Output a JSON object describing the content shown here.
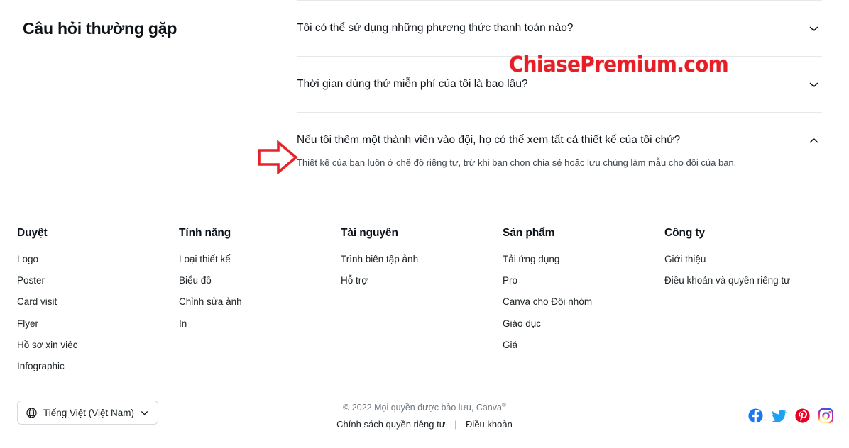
{
  "faq": {
    "title": "Câu hỏi thường gặp",
    "items": [
      {
        "question": "Tôi có thể sử dụng những phương thức thanh toán nào?",
        "answer": "",
        "expanded": false,
        "chevron": "chevron-down-icon"
      },
      {
        "question": "Thời gian dùng thử miễn phí của tôi là bao lâu?",
        "answer": "",
        "expanded": false,
        "chevron": "chevron-down-icon"
      },
      {
        "question": "Nếu tôi thêm một thành viên vào đội, họ có thể xem tất cả thiết kế của tôi chứ?",
        "answer": "Thiết kế của bạn luôn ở chế độ riêng tư, trừ khi bạn chọn chia sẻ hoặc lưu chúng làm mẫu cho đội của bạn.",
        "expanded": true,
        "chevron": "chevron-up-icon"
      }
    ]
  },
  "watermark": {
    "text": "ChiasePremium.com",
    "color": "#e81e26"
  },
  "annotation": {
    "arrow": "red-right-arrow-annotation",
    "color": "#e8222a"
  },
  "footer": {
    "columns": [
      {
        "heading": "Duyệt",
        "links": [
          "Logo",
          "Poster",
          "Card visit",
          "Flyer",
          "Hồ sơ xin việc",
          "Infographic"
        ]
      },
      {
        "heading": "Tính năng",
        "links": [
          "Loại thiết kế",
          "Biểu đồ",
          "Chỉnh sửa ảnh",
          "In"
        ]
      },
      {
        "heading": "Tài nguyên",
        "links": [
          "Trình biên tập ảnh",
          "Hỗ trợ"
        ]
      },
      {
        "heading": "Sản phẩm",
        "links": [
          "Tải ứng dụng",
          "Pro",
          "Canva cho Đội nhóm",
          "Giáo dục",
          "Giá"
        ]
      },
      {
        "heading": "Công ty",
        "links": [
          "Giới thiệu",
          "Điều khoản và quyền riêng tư"
        ]
      }
    ]
  },
  "bottom": {
    "language": {
      "icon": "globe-icon",
      "label": "Tiếng Việt (Việt Nam)",
      "chevron": "chevron-down-icon"
    },
    "copyright": "© 2022 Mọi quyền được bảo lưu, Canva",
    "copyright_mark": "®",
    "privacy_link": "Chính sách quyền riêng tư",
    "separator": "|",
    "terms_link": "Điều khoản",
    "socials": [
      {
        "name": "facebook-icon",
        "color": "#1877f2"
      },
      {
        "name": "twitter-icon",
        "color": "#1da1f2"
      },
      {
        "name": "pinterest-icon",
        "color": "#e60023"
      },
      {
        "name": "instagram-icon",
        "color": "#e1306c"
      }
    ]
  }
}
